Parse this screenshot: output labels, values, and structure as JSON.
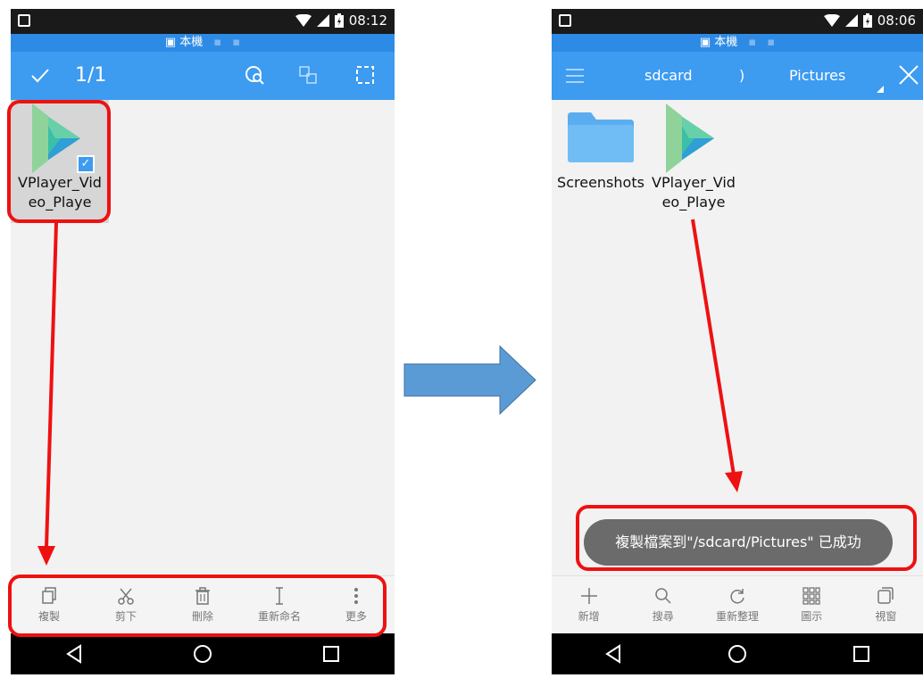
{
  "left_screen": {
    "status_time": "08:12",
    "location_label": "本機",
    "selection_count": "1/1",
    "file": {
      "name": "VPlayer_Video_Playe",
      "selected": true
    },
    "bottom_actions": [
      {
        "label": "複製",
        "icon": "copy-icon"
      },
      {
        "label": "剪下",
        "icon": "scissors-icon"
      },
      {
        "label": "刪除",
        "icon": "trash-icon"
      },
      {
        "label": "重新命名",
        "icon": "text-cursor-icon"
      },
      {
        "label": "更多",
        "icon": "more-vertical-icon"
      }
    ]
  },
  "right_screen": {
    "status_time": "08:06",
    "location_label": "本機",
    "breadcrumb": {
      "root": "sdcard",
      "separator": ")",
      "current": "Pictures"
    },
    "files": [
      {
        "name": "Screenshots",
        "type": "folder"
      },
      {
        "name": "VPlayer_Video_Playe",
        "type": "app"
      }
    ],
    "toast": "複製檔案到\"/sdcard/Pictures\" 已成功",
    "bottom_actions": [
      {
        "label": "新增",
        "icon": "plus-icon"
      },
      {
        "label": "搜尋",
        "icon": "search-icon"
      },
      {
        "label": "重新整理",
        "icon": "refresh-icon"
      },
      {
        "label": "圖示",
        "icon": "grid-icon"
      },
      {
        "label": "視窗",
        "icon": "windows-icon"
      }
    ]
  },
  "colors": {
    "toolbar_blue": "#3d9bf0",
    "location_blue": "#2e8be5",
    "highlight_red": "#ee1111",
    "arrow_blue": "#5b9bd5"
  }
}
